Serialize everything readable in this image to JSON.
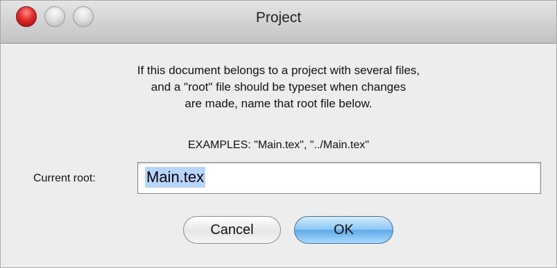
{
  "window": {
    "title": "Project"
  },
  "dialog": {
    "message_lines": [
      "If this document belongs to a project with several files,",
      "and a \"root\" file should be typeset when changes",
      "are made, name that root file below."
    ],
    "examples": "EXAMPLES: \"Main.tex\", \"../Main.tex\"",
    "current_root_label": "Current root:",
    "current_root_value": "Main.tex"
  },
  "buttons": {
    "cancel_label": "Cancel",
    "ok_label": "OK"
  },
  "colors": {
    "close_button": "#e02a2a",
    "default_button": "#5ea9e8",
    "selection": "#b5d5ff"
  },
  "icons": {
    "close": "close-icon",
    "minimize": "minimize-icon",
    "zoom": "zoom-icon"
  }
}
